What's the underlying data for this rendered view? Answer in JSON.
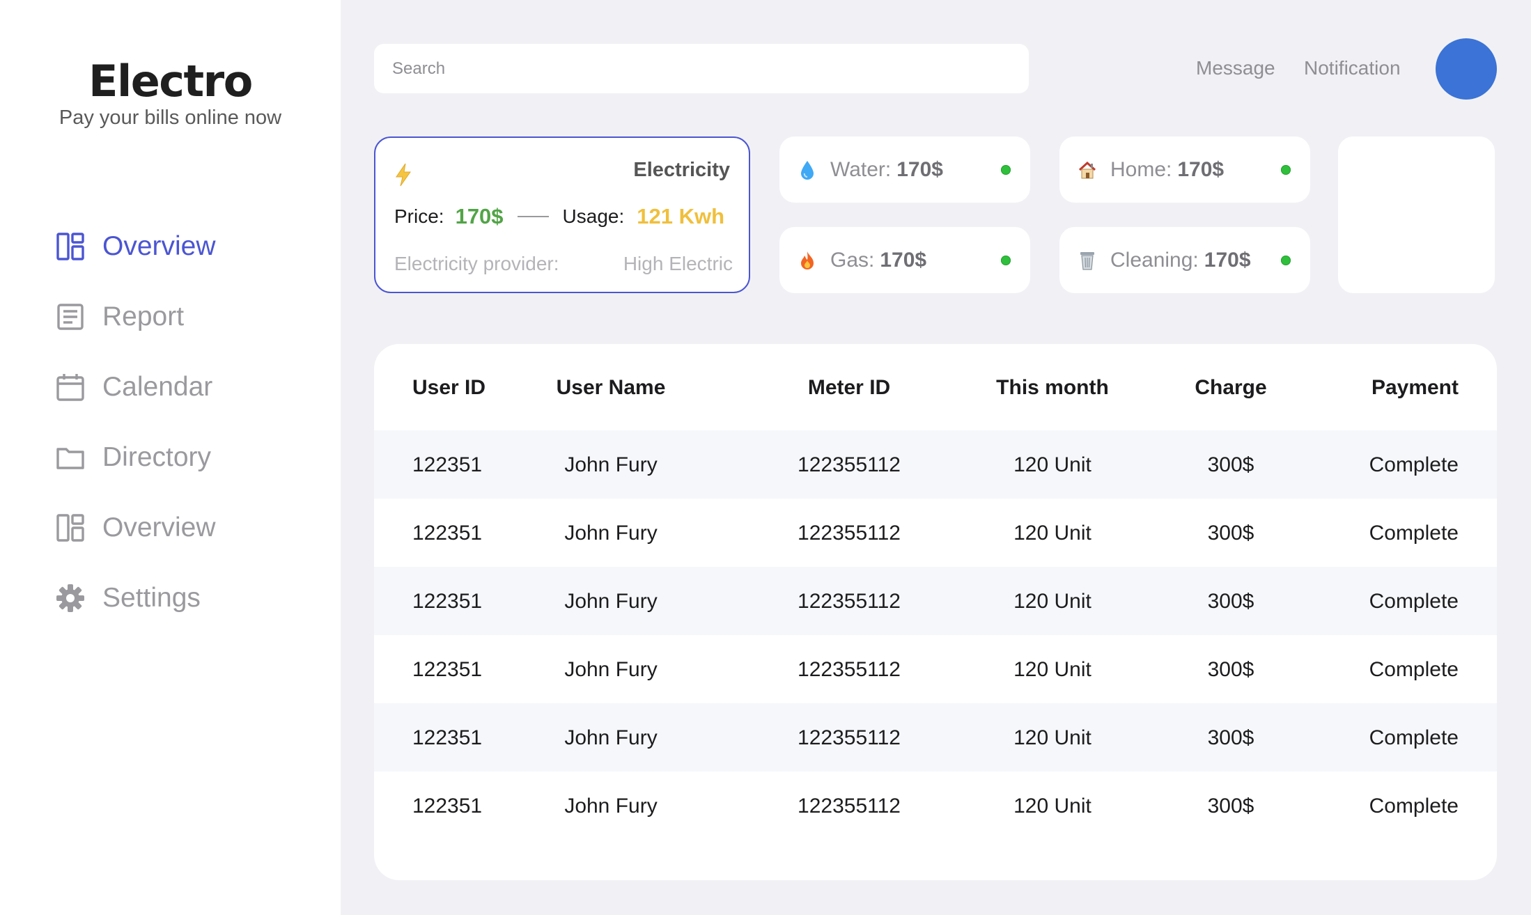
{
  "brand": {
    "title": "Electro",
    "subtitle": "Pay your bills online now"
  },
  "nav": [
    {
      "label": "Overview",
      "icon": "dashboard-icon",
      "active": true
    },
    {
      "label": "Report",
      "icon": "report-icon",
      "active": false
    },
    {
      "label": "Calendar",
      "icon": "calendar-icon",
      "active": false
    },
    {
      "label": "Directory",
      "icon": "folder-icon",
      "active": false
    },
    {
      "label": "Overview",
      "icon": "dashboard-icon",
      "active": false
    },
    {
      "label": "Settings",
      "icon": "gear-icon",
      "active": false
    }
  ],
  "search": {
    "placeholder": "Search"
  },
  "topbar": {
    "message": "Message",
    "notification": "Notification"
  },
  "electricity": {
    "title": "Electricity",
    "price_label": "Price:",
    "price_value": "170$",
    "usage_label": "Usage:",
    "usage_value": "121 Kwh",
    "provider_label": "Electricity provider:",
    "provider_value": "High Electric"
  },
  "bills": [
    {
      "label": "Water:",
      "value": "170$",
      "icon": "water-drop-icon",
      "status_color": "#2fbf3c"
    },
    {
      "label": "Home:",
      "value": "170$",
      "icon": "house-icon",
      "status_color": "#2fbf3c"
    },
    {
      "label": "Gas:",
      "value": "170$",
      "icon": "fire-icon",
      "status_color": "#2fbf3c"
    },
    {
      "label": "Cleaning:",
      "value": "170$",
      "icon": "trash-bin-icon",
      "status_color": "#2fbf3c"
    }
  ],
  "table": {
    "columns": [
      "User ID",
      "User Name",
      "Meter ID",
      "This month",
      "Charge",
      "Payment"
    ],
    "rows": [
      [
        "122351",
        "John Fury",
        "122355112",
        "120 Unit",
        "300$",
        "Complete"
      ],
      [
        "122351",
        "John Fury",
        "122355112",
        "120 Unit",
        "300$",
        "Complete"
      ],
      [
        "122351",
        "John Fury",
        "122355112",
        "120 Unit",
        "300$",
        "Complete"
      ],
      [
        "122351",
        "John Fury",
        "122355112",
        "120 Unit",
        "300$",
        "Complete"
      ],
      [
        "122351",
        "John Fury",
        "122355112",
        "120 Unit",
        "300$",
        "Complete"
      ],
      [
        "122351",
        "John Fury",
        "122355112",
        "120 Unit",
        "300$",
        "Complete"
      ]
    ]
  },
  "colors": {
    "accent": "#4b55d2",
    "price": "#52a447",
    "usage": "#f0bf3c",
    "avatar": "#3b73d6",
    "status_ok": "#2fbf3c"
  }
}
